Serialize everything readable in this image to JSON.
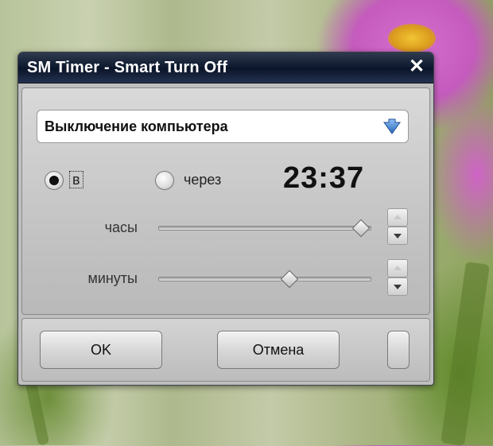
{
  "window": {
    "title": "SM Timer - Smart Turn Off",
    "close_glyph": "✕"
  },
  "action_select": {
    "value": "Выключение компьютера",
    "icon": "chevron-down-icon"
  },
  "mode": {
    "at_label": "в",
    "after_label": "через",
    "selected": "at"
  },
  "time_display": "23:37",
  "hours": {
    "label": "часы",
    "slider_fraction": 0.96
  },
  "minutes": {
    "label": "минуты",
    "slider_fraction": 0.62
  },
  "buttons": {
    "ok": "OK",
    "cancel": "Отмена",
    "extra": ""
  },
  "colors": {
    "titlebar": "#0e1a30",
    "dialog_bg": "#bfbfbf",
    "arrow_blue": "#3a7fd0"
  }
}
